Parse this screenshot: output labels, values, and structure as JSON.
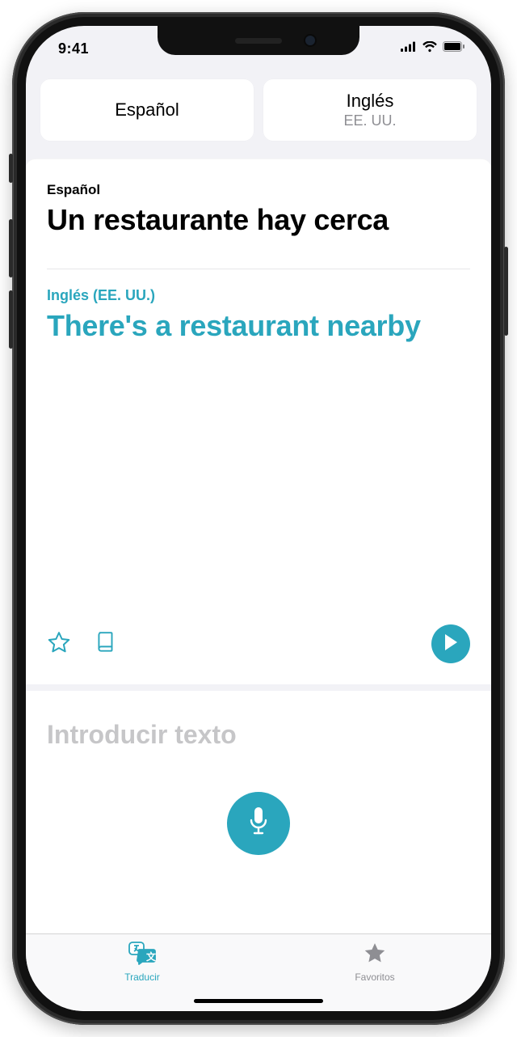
{
  "status": {
    "time": "9:41"
  },
  "languages": {
    "source": {
      "name": "Español",
      "sub": ""
    },
    "target": {
      "name": "Inglés",
      "sub": "EE. UU."
    }
  },
  "translation": {
    "source_lang_label": "Español",
    "source_text": "Un restaurante hay cerca",
    "target_lang_label": "Inglés (EE. UU.)",
    "target_text": "There's a restaurant nearby"
  },
  "input": {
    "placeholder": "Introducir texto"
  },
  "tabs": {
    "translate": "Traducir",
    "favorites": "Favoritos"
  },
  "colors": {
    "accent": "#2aa6bd"
  }
}
